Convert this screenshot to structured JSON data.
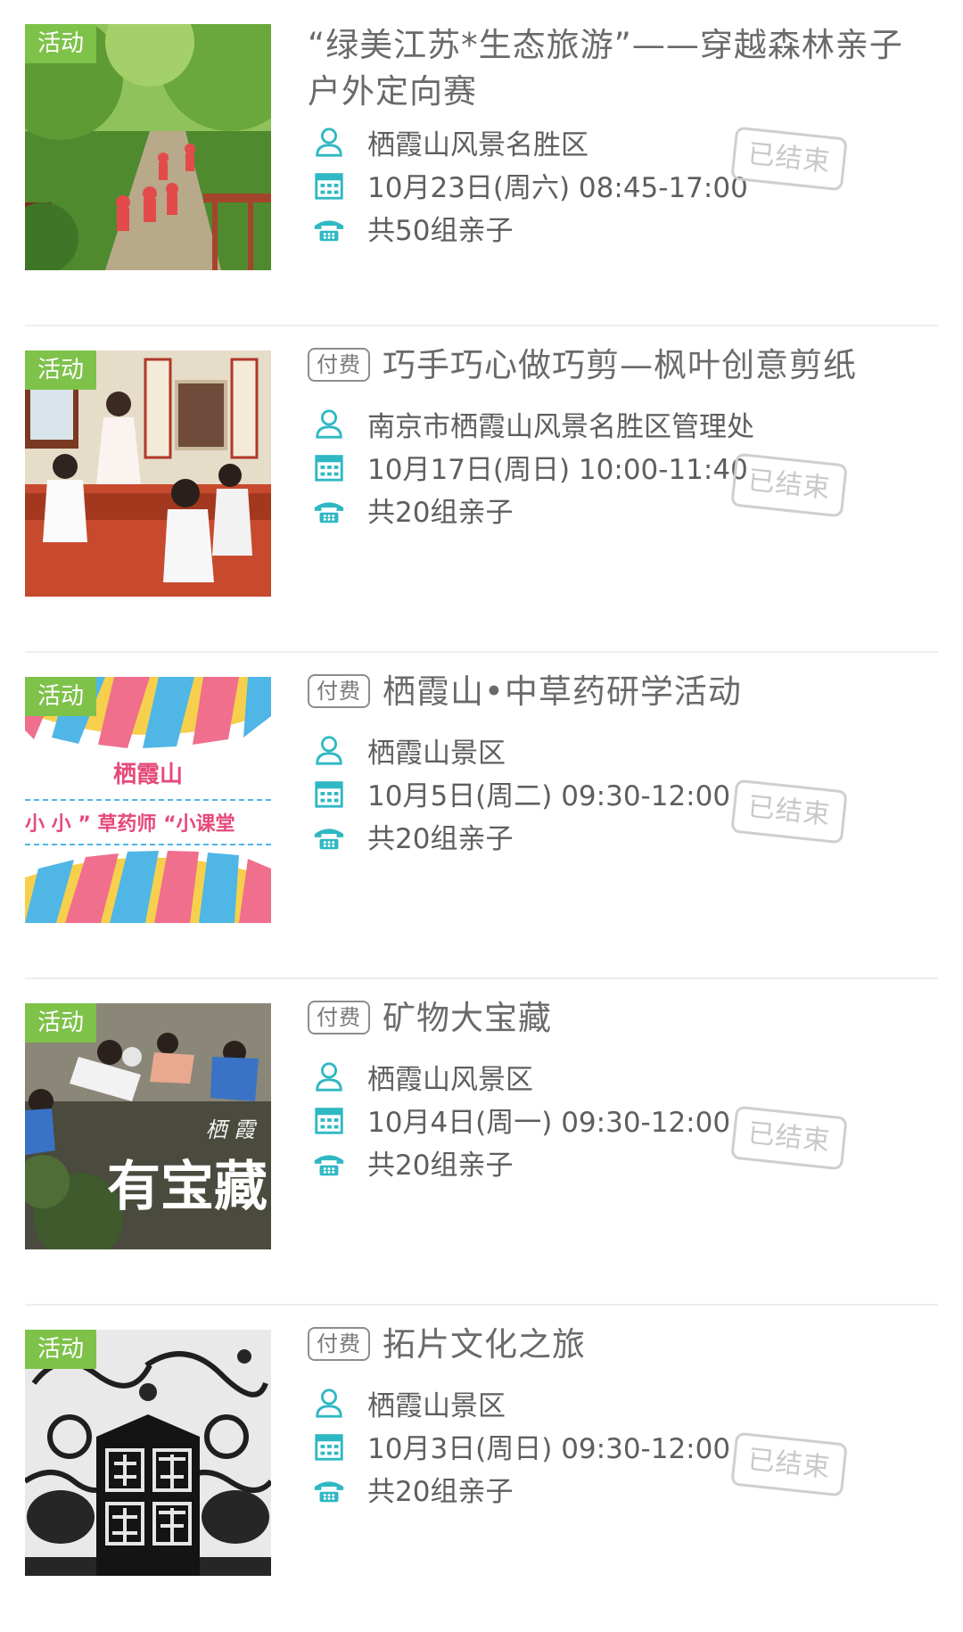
{
  "tag_label": "活动",
  "paid_label": "付费",
  "status_label": "已结束",
  "colors": {
    "tag_green": "#7ec24a",
    "icon_teal": "#2fb8c3"
  },
  "icons": {
    "organizer": "person-icon",
    "date": "calendar-icon",
    "capacity": "phone-icon"
  },
  "events": [
    {
      "title": "“绿美江苏*生态旅游”——穿越森林亲子户外定向赛",
      "paid": false,
      "organizer": "栖霞山风景名胜区",
      "datetime": "10月23日(周六) 08:45-17:00",
      "capacity": "共50组亲子"
    },
    {
      "title": "巧手巧心做巧剪—枫叶创意剪纸",
      "paid": true,
      "organizer": "南京市栖霞山风景名胜区管理处",
      "datetime": "10月17日(周日) 10:00-11:40",
      "capacity": "共20组亲子"
    },
    {
      "title": "栖霞山•中草药研学活动",
      "paid": true,
      "organizer": "栖霞山景区",
      "datetime": "10月5日(周二) 09:30-12:00",
      "capacity": "共20组亲子",
      "thumb_text": {
        "line1": "栖霞山",
        "line2": "小 小 ” 草药师 “小课堂"
      }
    },
    {
      "title": "矿物大宝藏",
      "paid": true,
      "organizer": "栖霞山风景区",
      "datetime": "10月4日(周一) 09:30-12:00",
      "capacity": "共20组亲子",
      "thumb_text": {
        "small": "栖 霞",
        "big": "有宝藏"
      }
    },
    {
      "title": "拓片文化之旅",
      "paid": true,
      "organizer": "栖霞山景区",
      "datetime": "10月3日(周日) 09:30-12:00",
      "capacity": "共20组亲子"
    }
  ]
}
